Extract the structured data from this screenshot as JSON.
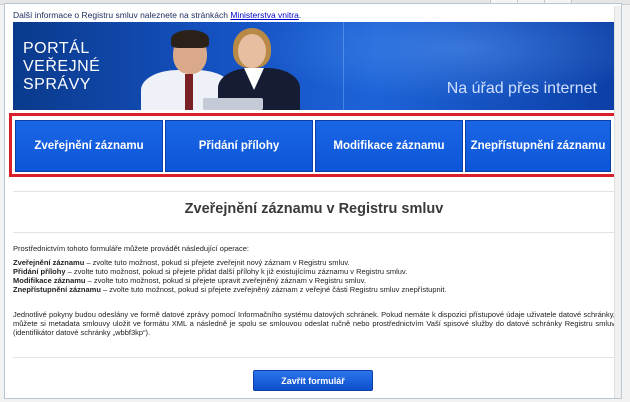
{
  "info": {
    "prefix": "Další informace o Registru smluv naleznete na stránkách",
    "link": "Ministerstva vnitra",
    "suffix": "."
  },
  "banner": {
    "title_line1": "PORTÁL",
    "title_line2": "VEŘEJNÉ",
    "title_line3": "SPRÁVY",
    "slogan": "Na úřad přes internet"
  },
  "nav": [
    {
      "label": "Zveřejnění záznamu"
    },
    {
      "label": "Přidání přílohy"
    },
    {
      "label": "Modifikace záznamu"
    },
    {
      "label": "Znepřístupnění záznamu"
    }
  ],
  "heading": "Zveřejnění záznamu v Registru smluv",
  "intro": "Prostřednictvím tohoto formuláře můžete provádět následující operace:",
  "operations": [
    {
      "term": "Zveřejnění záznamu",
      "desc": " – zvolte tuto možnost, pokud si přejete zveřejnit nový záznam v Registru smluv."
    },
    {
      "term": "Přidání přílohy",
      "desc": " – zvolte tuto možnost, pokud si přejete přidat další přílohy k již existujícímu záznamu v Registru smluv."
    },
    {
      "term": "Modifikace záznamu",
      "desc": " – zvolte tuto možnost, pokud si přejete upravit zveřejněný záznam v Registru smluv."
    },
    {
      "term": "Znepřístupnění záznamu",
      "desc": " – zvolte tuto možnost, pokud si přejete zveřejněný záznam z veřejné části Registru smluv znepřístupnit."
    }
  ],
  "paragraph": "Jednotlivé pokyny budou odeslány ve formě datové zprávy pomocí Informačního systému datových schránek. Pokud nemáte k dispozici přístupové údaje uživatele datové schránky, můžete si metadata smlouvy uložit ve formátu XML a následně je spolu se smlouvou odeslat ručně nebo prostřednictvím Vaší spisové služby do datové schránky Registru smluv (identifikátor datové schránky „wbbf3kp“).",
  "close_label": "Zavřít formulář",
  "colors": {
    "accent": "#0d55d8",
    "nav_border": "#d81f2a",
    "banner": "#1552c2"
  }
}
